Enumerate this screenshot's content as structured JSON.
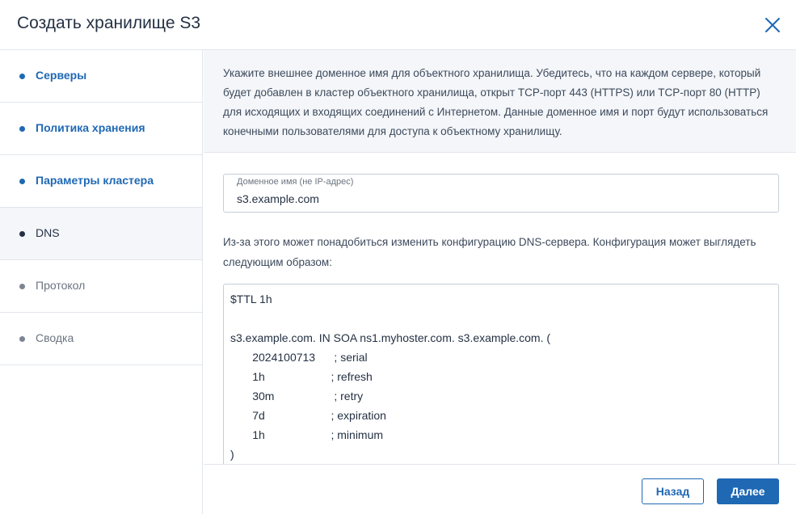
{
  "dialog": {
    "title": "Создать хранилище S3"
  },
  "steps": [
    {
      "label": "Серверы",
      "state": "done"
    },
    {
      "label": "Политика хранения",
      "state": "done"
    },
    {
      "label": "Параметры кластера",
      "state": "done"
    },
    {
      "label": "DNS",
      "state": "active"
    },
    {
      "label": "Протокол",
      "state": "pending"
    },
    {
      "label": "Сводка",
      "state": "pending"
    }
  ],
  "info": {
    "text": "Укажите внешнее доменное имя для объектного хранилища. Убедитесь, что на каждом сервере, который будет добавлен в кластер объектного хранилища, открыт TCP-порт 443 (HTTPS) или TCP-порт 80 (HTTP) для исходящих и входящих соединений с Интернетом. Данные доменное имя и порт будут использоваться конечными пользователями для доступа к объектному хранилищу."
  },
  "domain_field": {
    "label": "Доменное имя (не IP-адрес)",
    "value": "s3.example.com"
  },
  "hint": {
    "text": "Из-за этого может понадобиться изменить конфигурацию DNS-сервера. Конфигурация может выглядеть следующим образом:"
  },
  "dns_config": {
    "lines": [
      "$TTL 1h",
      "",
      "s3.example.com. IN SOA ns1.myhoster.com. s3.example.com. (",
      "       2024100713      ; serial",
      "       1h                     ; refresh",
      "       30m                   ; retry",
      "       7d                     ; expiration",
      "       1h                     ; minimum",
      ")"
    ]
  },
  "footer": {
    "back_label": "Назад",
    "next_label": "Далее"
  },
  "colors": {
    "accent": "#1f68b4",
    "text": "#243143",
    "active_step_bg": "#f4f6f9",
    "border": "#e1e6ec"
  }
}
